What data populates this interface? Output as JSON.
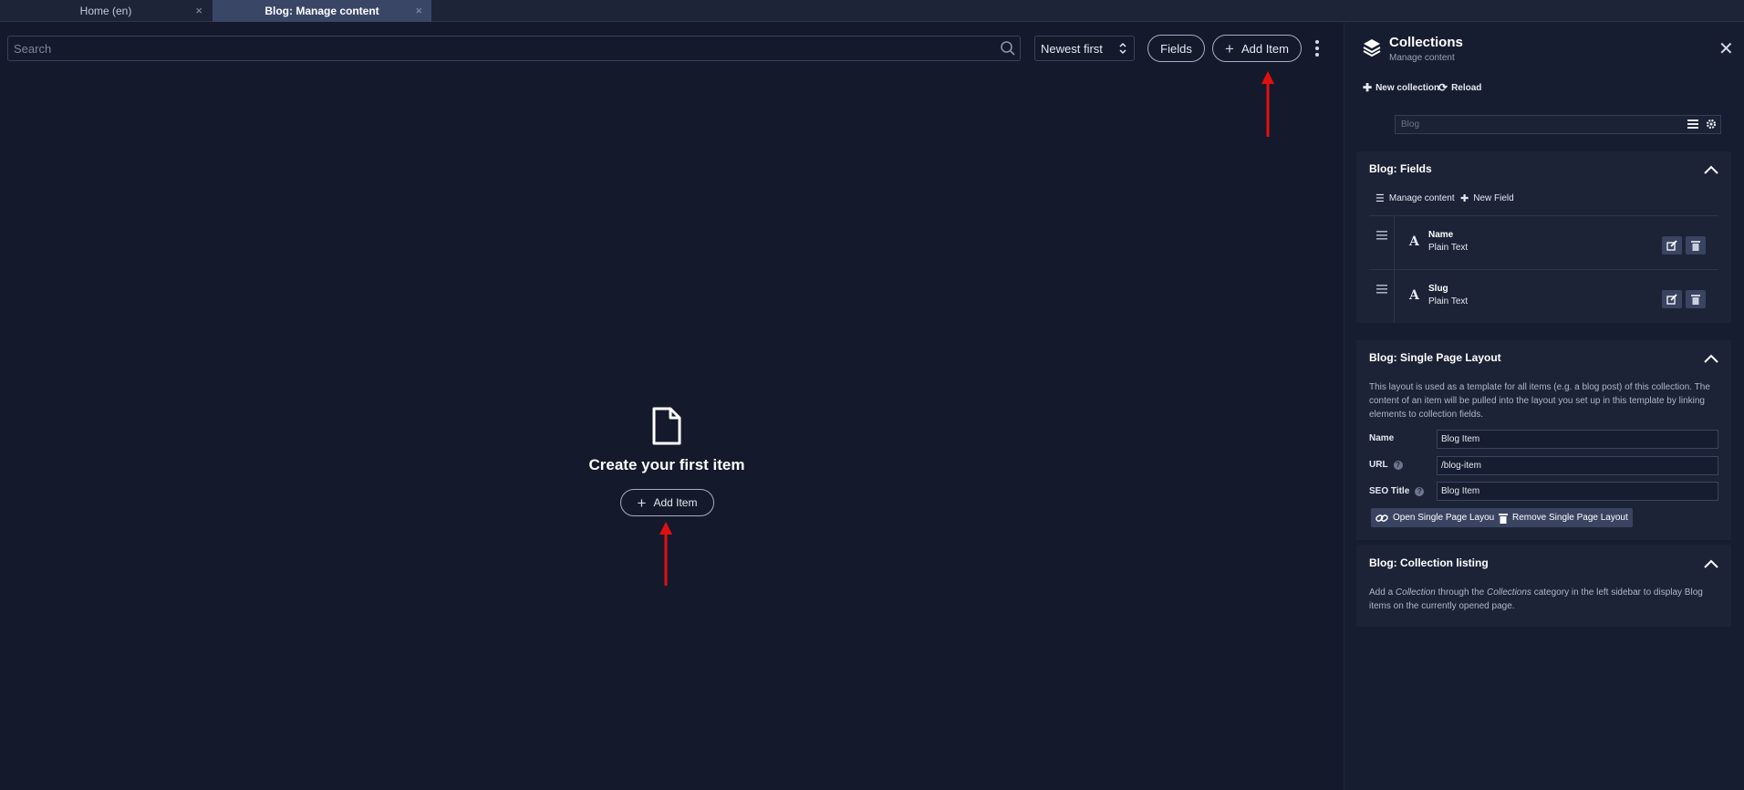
{
  "tabs": [
    {
      "label": "Home (en)",
      "active": false
    },
    {
      "label": "Blog: Manage content",
      "active": true
    }
  ],
  "toolbar": {
    "search_placeholder": "Search",
    "sort_value": "Newest first",
    "fields_label": "Fields",
    "add_item_label": "Add Item"
  },
  "empty_state": {
    "title": "Create your first item",
    "add_item_label": "Add Item"
  },
  "panel": {
    "title": "Collections",
    "subtitle": "Manage content",
    "new_collection_label": "New collection",
    "reload_label": "Reload",
    "collection_name": "Blog",
    "fields_section": {
      "title": "Blog: Fields",
      "manage_content_label": "Manage content",
      "new_field_label": "New Field",
      "fields": [
        {
          "name": "Name",
          "type": "Plain Text"
        },
        {
          "name": "Slug",
          "type": "Plain Text"
        }
      ]
    },
    "layout_section": {
      "title": "Blog: Single Page Layout",
      "description": "This layout is used as a template for all items (e.g. a blog post) of this collection. The content of an item will be pulled into the layout you set up in this template by linking elements to collection fields.",
      "name_label": "Name",
      "name_value": "Blog Item",
      "url_label": "URL",
      "url_value": "/blog-item",
      "seo_label": "SEO Title",
      "seo_value": "Blog Item",
      "open_label": "Open Single Page Layout",
      "remove_label": "Remove Single Page Layout"
    },
    "listing_section": {
      "title": "Blog: Collection listing",
      "desc_add": "Add a",
      "desc_collection": "Collection",
      "desc_through": "through the",
      "desc_collections": "Collections",
      "desc_rest": "category in the left sidebar to display Blog items on the currently opened page."
    }
  },
  "colors": {
    "background": "#141a2c",
    "panel": "#171d30",
    "section": "#1c2337",
    "active_tab": "#3a4666",
    "annotation_arrow": "#e01010"
  }
}
